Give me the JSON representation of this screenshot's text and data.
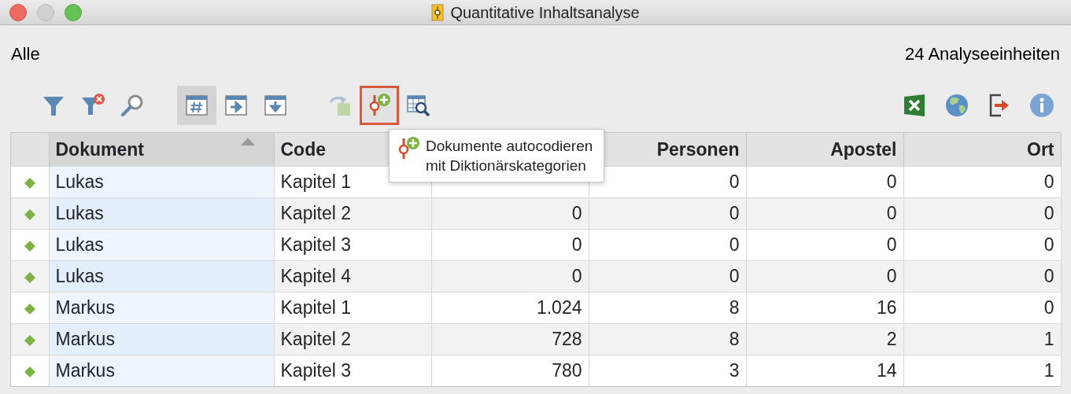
{
  "window": {
    "title": "Quantitative Inhaltsanalyse"
  },
  "filter_label": "Alle",
  "unit_count": "24 Analyseeinheiten",
  "toolbar": {
    "groups": [
      [
        {
          "kind": "filter",
          "disabled": false,
          "highlighted": false
        },
        {
          "kind": "filter-clear",
          "disabled": false,
          "highlighted": false
        },
        {
          "kind": "search",
          "disabled": false,
          "highlighted": false
        }
      ],
      [
        {
          "kind": "table-hash",
          "selected": true,
          "highlighted": false
        },
        {
          "kind": "table-right",
          "selected": false,
          "highlighted": false
        },
        {
          "kind": "table-down",
          "selected": false,
          "highlighted": false
        }
      ],
      [
        {
          "kind": "redo",
          "disabled": true,
          "highlighted": false
        },
        {
          "kind": "autocode",
          "disabled": false,
          "highlighted": true
        },
        {
          "kind": "table-search",
          "disabled": false,
          "highlighted": false
        }
      ]
    ],
    "right": [
      {
        "kind": "excel"
      },
      {
        "kind": "globe"
      },
      {
        "kind": "exit"
      },
      {
        "kind": "info"
      }
    ]
  },
  "tooltip": {
    "text": "Dokumente autocodieren\nmit Diktionärskategorien"
  },
  "table": {
    "columns": [
      {
        "label": "Dokument",
        "kind": "text",
        "sorted": true
      },
      {
        "label": "Code",
        "kind": "text",
        "sorted": false
      },
      {
        "kind": "number"
      },
      {
        "label": "Personen",
        "kind": "number",
        "sorted": false
      },
      {
        "label": "Apostel",
        "kind": "number",
        "sorted": false
      },
      {
        "label": "Ort",
        "kind": "number",
        "sorted": false
      }
    ],
    "rows": [
      {
        "cells": [
          "Lukas",
          "Kapitel 1",
          null,
          "0",
          "0",
          "0"
        ]
      },
      {
        "cells": [
          "Lukas",
          "Kapitel 2",
          "0",
          "0",
          "0",
          "0"
        ]
      },
      {
        "cells": [
          "Lukas",
          "Kapitel 3",
          "0",
          "0",
          "0",
          "0"
        ]
      },
      {
        "cells": [
          "Lukas",
          "Kapitel 4",
          "0",
          "0",
          "0",
          "0"
        ]
      },
      {
        "cells": [
          "Markus",
          "Kapitel 1",
          "1.024",
          "8",
          "16",
          "0"
        ]
      },
      {
        "cells": [
          "Markus",
          "Kapitel 2",
          "728",
          "8",
          "2",
          "1"
        ]
      },
      {
        "cells": [
          "Markus",
          "Kapitel 3",
          "780",
          "3",
          "14",
          "1"
        ]
      }
    ]
  }
}
